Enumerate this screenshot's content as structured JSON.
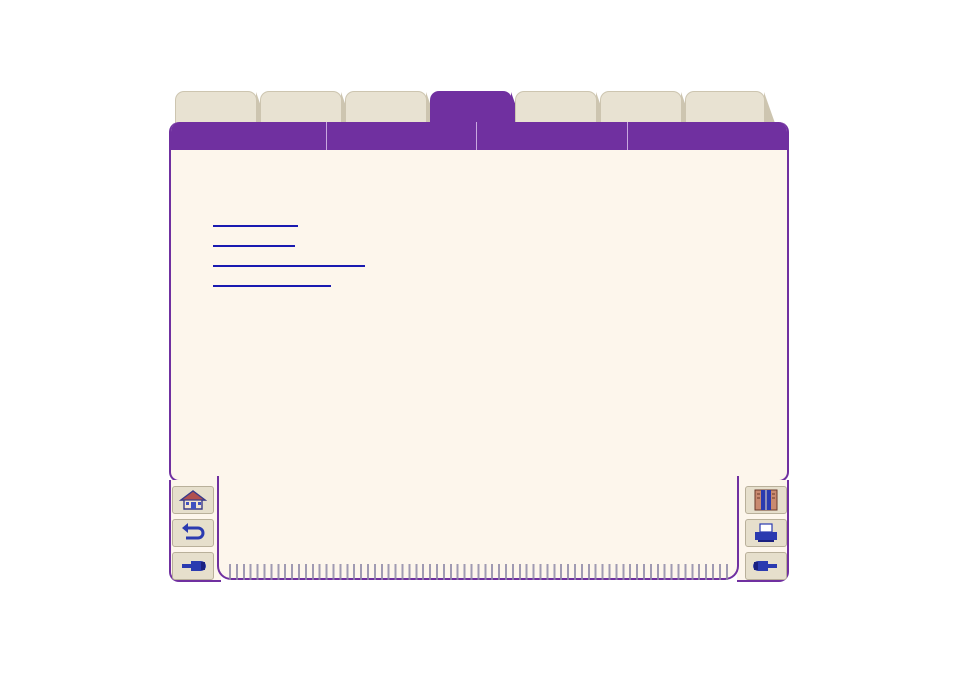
{
  "tabs": [
    {
      "id": "tab-1",
      "active": false
    },
    {
      "id": "tab-2",
      "active": false
    },
    {
      "id": "tab-3",
      "active": false
    },
    {
      "id": "tab-4",
      "active": true
    },
    {
      "id": "tab-5",
      "active": false
    },
    {
      "id": "tab-6",
      "active": false
    },
    {
      "id": "tab-7",
      "active": false
    }
  ],
  "subnav_segments": 4,
  "links": [
    "",
    "",
    "",
    ""
  ],
  "nav": {
    "left": [
      "home-icon",
      "back-arrow-icon",
      "previous-page-icon"
    ],
    "right": [
      "contents-book-icon",
      "printer-icon",
      "next-page-icon"
    ]
  },
  "colors": {
    "accent": "#7030a0",
    "page": "#fdf6ec",
    "tab_inactive": "#e8e2d2",
    "link": "#1a1ab0"
  }
}
